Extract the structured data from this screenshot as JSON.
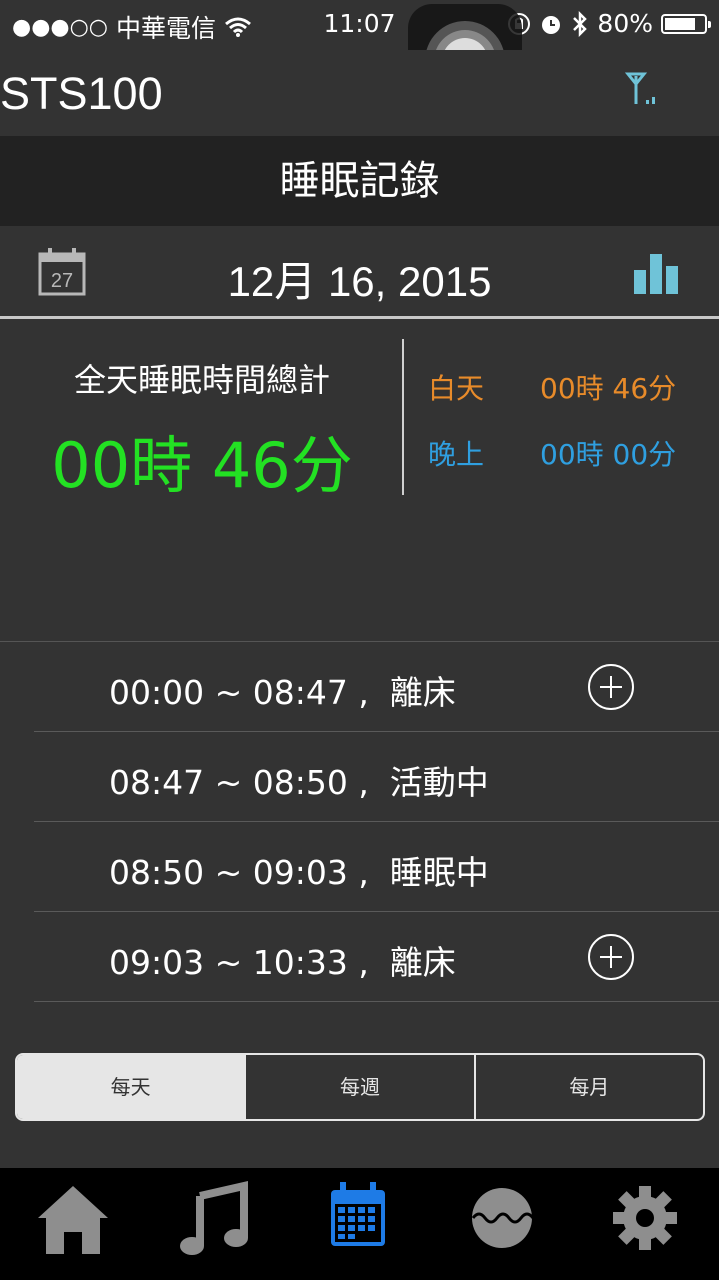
{
  "status_bar": {
    "signal_dots": "●●●○○",
    "carrier": "中華電信",
    "time": "11:07",
    "battery_percent": "80%",
    "battery_level": 0.8,
    "icons": [
      "wifi-icon",
      "orientation-lock-icon",
      "alarm-icon",
      "bluetooth-icon",
      "battery-icon"
    ]
  },
  "header": {
    "app_title": "STS100",
    "right_icon": "antenna-signal-icon"
  },
  "section": {
    "title": "睡眠記錄"
  },
  "date_row": {
    "calendar_day": "27",
    "date": "12月 16, 2015",
    "right_icon": "bar-chart-icon"
  },
  "summary": {
    "total_label": "全天睡眠時間總計",
    "total_value": "00時 46分",
    "day_label": "白天",
    "day_value": "00時 46分",
    "night_label": "晚上",
    "night_value": "00時 00分"
  },
  "records": [
    {
      "text": "00:00 ~ 08:47 ,  離床",
      "has_add": true
    },
    {
      "text": "08:47 ~ 08:50 ,  活動中",
      "has_add": false
    },
    {
      "text": "08:50 ~ 09:03 ,  睡眠中",
      "has_add": false
    },
    {
      "text": "09:03 ~ 10:33 ,  離床",
      "has_add": true
    }
  ],
  "period_tabs": [
    {
      "label": "每天",
      "active": true
    },
    {
      "label": "每週",
      "active": false
    },
    {
      "label": "每月",
      "active": false
    }
  ],
  "tab_bar": [
    {
      "icon": "home-icon",
      "active": false
    },
    {
      "icon": "music-icon",
      "active": false
    },
    {
      "icon": "calendar-icon",
      "active": true
    },
    {
      "icon": "wave-icon",
      "active": false
    },
    {
      "icon": "gear-icon",
      "active": false
    }
  ],
  "colors": {
    "total": "#23e123",
    "day": "#e88b2a",
    "night": "#2f9fe0",
    "active_tab": "#1e7be6",
    "inactive_tab": "#8e8e8e",
    "antenna": "#6fc3d8"
  }
}
